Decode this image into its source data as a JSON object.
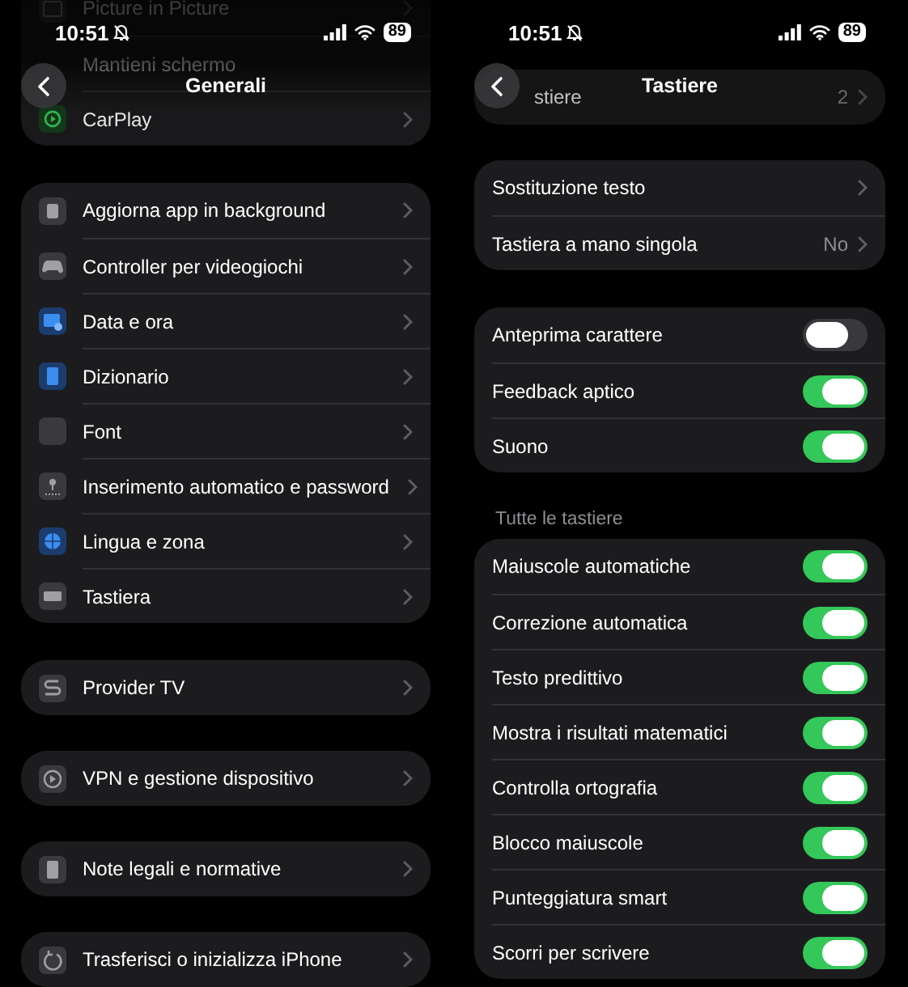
{
  "screens": [
    {
      "status": {
        "time": "10:51",
        "battery": "89"
      },
      "nav": {
        "title": "Generali"
      },
      "behind": [
        {
          "kind": "icon_link",
          "label": "Picture in Picture"
        },
        {
          "kind": "plain",
          "label": "Mantieni schermo"
        },
        {
          "kind": "icon_link",
          "label": "CarPlay"
        }
      ],
      "groups": [
        {
          "rows": [
            {
              "kind": "icon_link",
              "label": "Aggiorna app in background"
            },
            {
              "kind": "icon_link",
              "label": "Controller per videogiochi"
            },
            {
              "kind": "icon_link",
              "label": "Data e ora"
            },
            {
              "kind": "icon_link",
              "label": "Dizionario"
            },
            {
              "kind": "icon_link",
              "label": "Font"
            },
            {
              "kind": "icon_link",
              "label": "Inserimento automatico e password"
            },
            {
              "kind": "icon_link",
              "label": "Lingua e zona"
            },
            {
              "kind": "icon_link",
              "label": "Tastiera"
            }
          ]
        },
        {
          "rows": [
            {
              "kind": "icon_link",
              "label": "Provider TV"
            }
          ]
        },
        {
          "rows": [
            {
              "kind": "icon_link",
              "label": "VPN e gestione dispositivo"
            }
          ]
        },
        {
          "rows": [
            {
              "kind": "icon_link",
              "label": "Note legali e normative"
            }
          ]
        },
        {
          "rows": [
            {
              "kind": "icon_link",
              "label": "Trasferisci o inizializza iPhone"
            }
          ]
        }
      ]
    },
    {
      "status": {
        "time": "10:51",
        "battery": "89"
      },
      "nav": {
        "title": "Tastiere"
      },
      "behind": [
        {
          "kind": "link",
          "label": "stiere",
          "value": "2"
        }
      ],
      "groups": [
        {
          "rows": [
            {
              "kind": "link",
              "label": "Sostituzione testo"
            },
            {
              "kind": "link",
              "label": "Tastiera a mano singola",
              "value": "No"
            }
          ]
        },
        {
          "rows": [
            {
              "kind": "toggle",
              "label": "Anteprima carattere",
              "on": false
            },
            {
              "kind": "toggle",
              "label": "Feedback aptico",
              "on": true
            },
            {
              "kind": "toggle",
              "label": "Suono",
              "on": true
            }
          ]
        },
        {
          "header": "Tutte le tastiere",
          "rows": [
            {
              "kind": "toggle",
              "label": "Maiuscole automatiche",
              "on": true
            },
            {
              "kind": "toggle",
              "label": "Correzione automatica",
              "on": true
            },
            {
              "kind": "toggle",
              "label": "Testo predittivo",
              "on": true
            },
            {
              "kind": "toggle",
              "label": "Mostra i risultati matematici",
              "on": true
            },
            {
              "kind": "toggle",
              "label": "Controlla ortografia",
              "on": true
            },
            {
              "kind": "toggle",
              "label": "Blocco maiuscole",
              "on": true
            },
            {
              "kind": "toggle",
              "label": "Punteggiatura smart",
              "on": true
            },
            {
              "kind": "toggle",
              "label": "Scorri per scrivere",
              "on": true
            }
          ]
        }
      ]
    }
  ]
}
